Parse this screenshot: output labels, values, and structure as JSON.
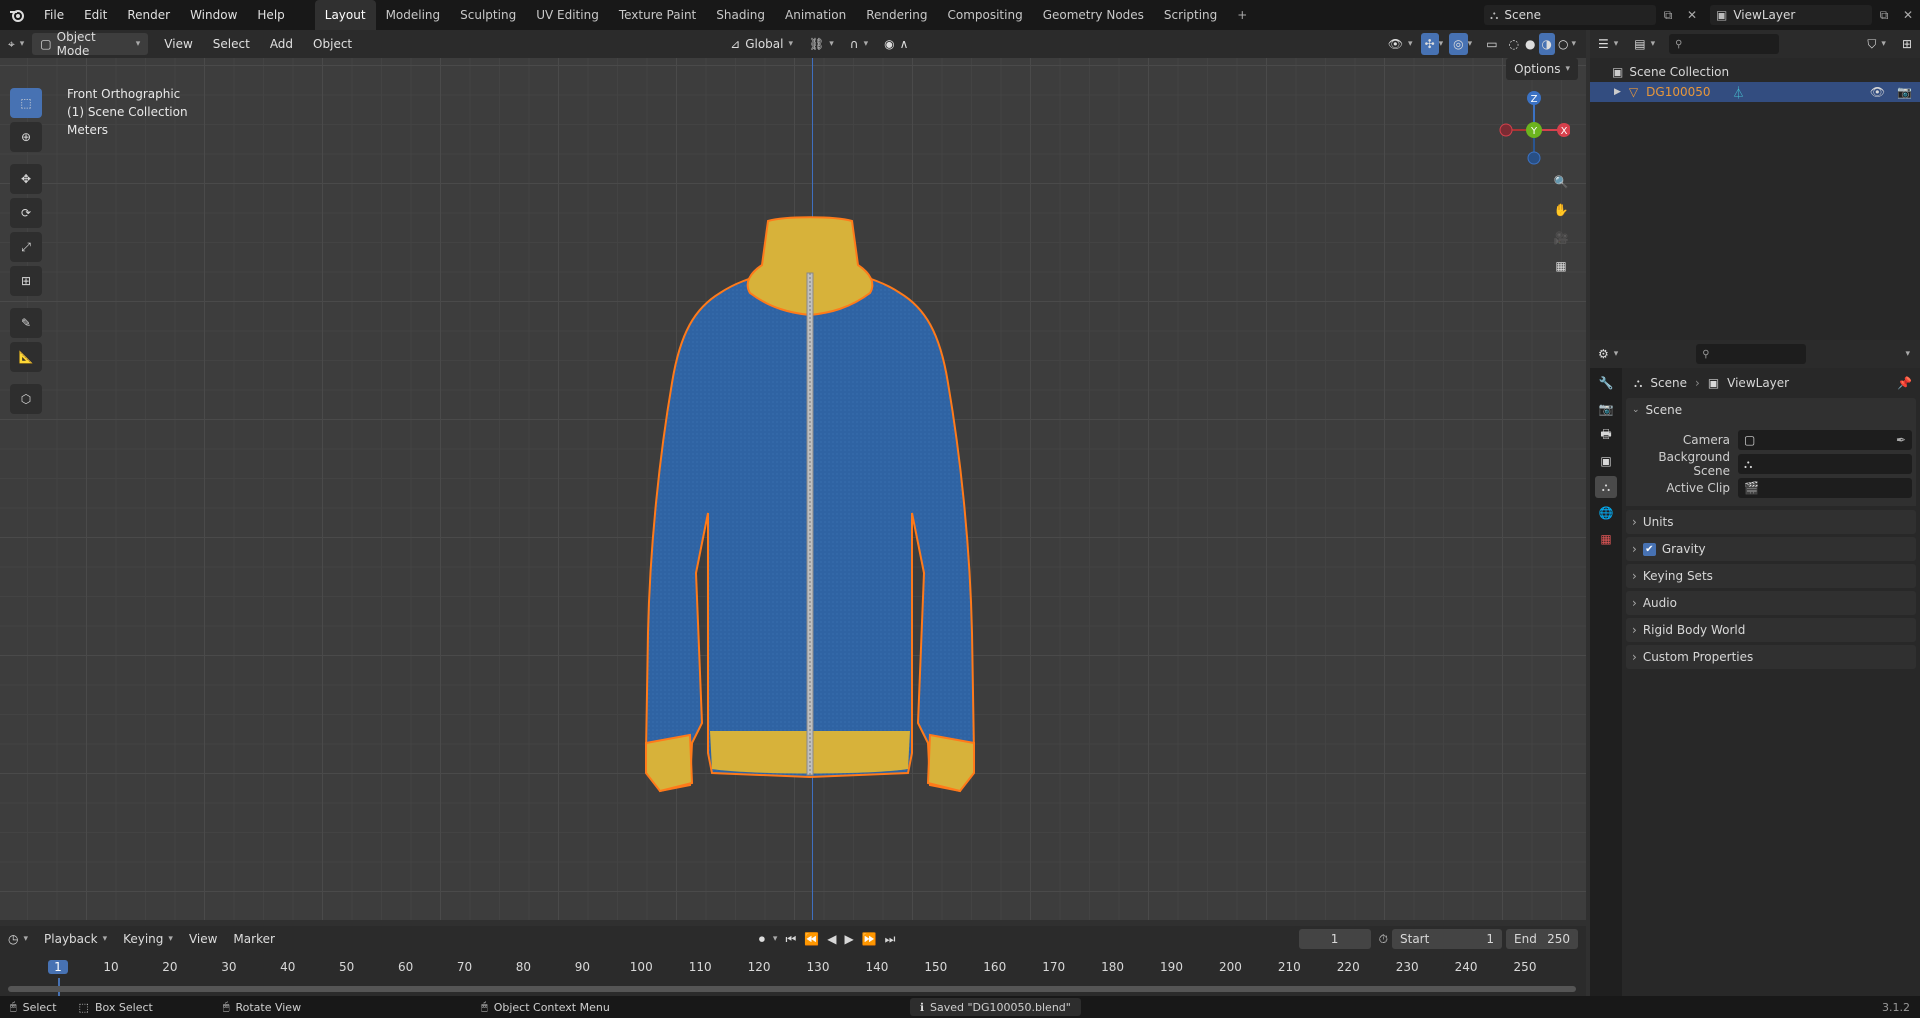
{
  "menus": [
    "File",
    "Edit",
    "Render",
    "Window",
    "Help"
  ],
  "workspaces": [
    "Layout",
    "Modeling",
    "Sculpting",
    "UV Editing",
    "Texture Paint",
    "Shading",
    "Animation",
    "Rendering",
    "Compositing",
    "Geometry Nodes",
    "Scripting"
  ],
  "active_workspace": "Layout",
  "scene_name": "Scene",
  "viewlayer_name": "ViewLayer",
  "viewport_header": {
    "mode": "Object Mode",
    "menus": [
      "View",
      "Select",
      "Add",
      "Object"
    ],
    "transform_orientation": "Global",
    "options_label": "Options"
  },
  "viewport_overlay": {
    "line1": "Front Orthographic",
    "line2": "(1) Scene Collection",
    "line3": "Meters"
  },
  "gizmo": {
    "z": "Z",
    "y": "Y",
    "x": "X"
  },
  "outliner": {
    "collection": "Scene Collection",
    "object": "DG100050"
  },
  "properties": {
    "breadcrumb_scene": "Scene",
    "breadcrumb_layer": "ViewLayer",
    "section": "Scene",
    "fields": {
      "camera": "Camera",
      "background_scene": "Background Scene",
      "active_clip": "Active Clip"
    },
    "panels": [
      "Units",
      "Gravity",
      "Keying Sets",
      "Audio",
      "Rigid Body World",
      "Custom Properties"
    ]
  },
  "timeline": {
    "menus": [
      "Playback",
      "Keying",
      "View",
      "Marker"
    ],
    "current_frame": "1",
    "start_label": "Start",
    "start": "1",
    "end_label": "End",
    "end": "250",
    "ruler": [
      "1",
      "10",
      "20",
      "30",
      "40",
      "50",
      "60",
      "70",
      "80",
      "90",
      "100",
      "110",
      "120",
      "130",
      "140",
      "150",
      "160",
      "170",
      "180",
      "190",
      "200",
      "210",
      "220",
      "230",
      "240",
      "250"
    ]
  },
  "statusbar": {
    "select": "Select",
    "box_select": "Box Select",
    "rotate_view": "Rotate View",
    "context_menu": "Object Context Menu",
    "message": "Saved \"DG100050.blend\"",
    "version": "3.1.2"
  },
  "colors": {
    "accent": "#4772b3",
    "jacket_blue": "#2f63a3",
    "jacket_yellow": "#d7b23a",
    "selection_outline": "#ff7a1a",
    "object_orange": "#e8973a"
  }
}
